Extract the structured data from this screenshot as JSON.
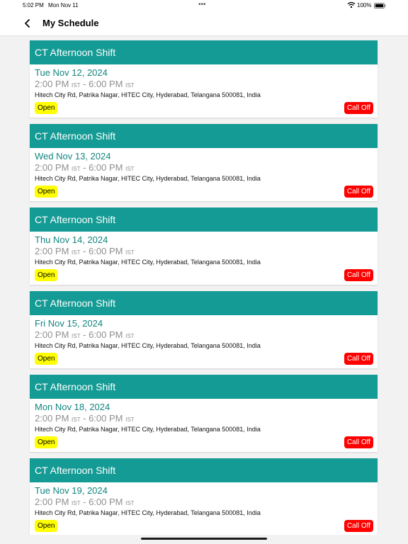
{
  "status_bar": {
    "time": "5:02 PM",
    "date": "Mon Nov 11",
    "dots": "•••",
    "battery_text": "100%",
    "icons": [
      "wifi-icon",
      "battery-icon"
    ]
  },
  "nav": {
    "back_icon": "chevron-left-icon",
    "title": "My Schedule"
  },
  "colors": {
    "header_teal": "#159b95",
    "date_teal": "#11857f",
    "open_badge_yellow": "#ffff00",
    "call_off_red": "#ff0000"
  },
  "shifts": [
    {
      "title": "CT Afternoon Shift",
      "date": "Tue Nov 12, 2024",
      "start": "2:00 PM",
      "start_tz": "IST",
      "end": "6:00 PM",
      "end_tz": "IST",
      "address": "Hitech City Rd, Patrika Nagar, HITEC City, Hyderabad, Telangana 500081, India",
      "status": "Open",
      "action": "Call Off"
    },
    {
      "title": "CT Afternoon Shift",
      "date": "Wed Nov 13, 2024",
      "start": "2:00 PM",
      "start_tz": "IST",
      "end": "6:00 PM",
      "end_tz": "IST",
      "address": "Hitech City Rd, Patrika Nagar, HITEC City, Hyderabad, Telangana 500081, India",
      "status": "Open",
      "action": "Call Off"
    },
    {
      "title": "CT Afternoon Shift",
      "date": "Thu Nov 14, 2024",
      "start": "2:00 PM",
      "start_tz": "IST",
      "end": "6:00 PM",
      "end_tz": "IST",
      "address": "Hitech City Rd, Patrika Nagar, HITEC City, Hyderabad, Telangana 500081, India",
      "status": "Open",
      "action": "Call Off"
    },
    {
      "title": "CT Afternoon Shift",
      "date": "Fri Nov 15, 2024",
      "start": "2:00 PM",
      "start_tz": "IST",
      "end": "6:00 PM",
      "end_tz": "IST",
      "address": "Hitech City Rd, Patrika Nagar, HITEC City, Hyderabad, Telangana 500081, India",
      "status": "Open",
      "action": "Call Off"
    },
    {
      "title": "CT Afternoon Shift",
      "date": "Mon Nov 18, 2024",
      "start": "2:00 PM",
      "start_tz": "IST",
      "end": "6:00 PM",
      "end_tz": "IST",
      "address": "Hitech City Rd, Patrika Nagar, HITEC City, Hyderabad, Telangana 500081, India",
      "status": "Open",
      "action": "Call Off"
    },
    {
      "title": "CT Afternoon Shift",
      "date": "Tue Nov 19, 2024",
      "start": "2:00 PM",
      "start_tz": "IST",
      "end": "6:00 PM",
      "end_tz": "IST",
      "address": "Hitech City Rd, Patrika Nagar, HITEC City, Hyderabad, Telangana 500081, India",
      "status": "Open",
      "action": "Call Off"
    }
  ]
}
